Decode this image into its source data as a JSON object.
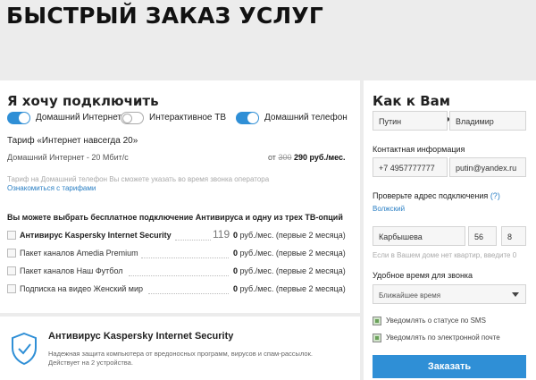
{
  "title": "БЫСТРЫЙ ЗАКАЗ УСЛУГ",
  "services": {
    "heading": "Я хочу подключить",
    "toggles": [
      {
        "label": "Домашний Интернет",
        "state": "on"
      },
      {
        "label": "Интерактивное ТВ",
        "state": "off"
      },
      {
        "label": "Домашний телефон",
        "state": "on"
      }
    ],
    "tariff": "Тариф «Интернет навсегда 20»",
    "tariff_line": "Домашний Интернет - 20 Мбит/с",
    "price_prefix": "от",
    "price_old": "300",
    "price_new": "290 руб./мес.",
    "tariff_note": "Тариф на Домашний телефон Вы сможете указать во время звонка оператора",
    "tariffs_link": "Ознакомиться с тарифами",
    "options_heading": "Вы можете выбрать бесплатное подключение Антивируса и одну из трех ТВ-опций",
    "options": [
      {
        "name": "Антивирус Kaspersky Internet Security",
        "old_price": "119",
        "price": "0",
        "suffix": "руб./мес. (первые 2 месяца)",
        "bold": true
      },
      {
        "name": "Пакет каналов Amedia Premium",
        "price": "0",
        "suffix": "руб./мес. (первые 2 месяца)"
      },
      {
        "name": "Пакет каналов Наш Футбол",
        "price": "0",
        "suffix": "руб./мес. (первые 2 месяца)"
      },
      {
        "name": "Подписка на видео Женский мир",
        "price": "0",
        "suffix": "руб./мес. (первые 2 месяца)"
      }
    ]
  },
  "promo": {
    "title": "Антивирус Kaspersky Internet Security",
    "line1": "Надежная защита компьютера от вредоносных программ, вирусов и спам-рассылок.",
    "line2": "Действует на 2 устройства."
  },
  "contact": {
    "heading": "Как к Вам обращаться",
    "last_name": "Путин",
    "first_name": "Владимир",
    "contact_heading": "Контактная информация",
    "phone": "+7 4957777777",
    "email": "putin@yandex.ru",
    "address_heading": "Проверьте адрес подключения",
    "help": "(?)",
    "city": "Волжский",
    "street": "Карбышева",
    "house": "56",
    "flat": "8",
    "address_hint": "Если в Вашем доме нет квартир, введите 0",
    "time_heading": "Удобное время для звонка",
    "time_value": "Ближайшее время",
    "sms_label": "Уведомлять о статусе по SMS",
    "mail_label": "Уведомлять по электронной почте",
    "submit": "Заказать"
  },
  "colors": {
    "accent": "#2f8fd6",
    "background": "#ececec",
    "panel": "#ffffff"
  }
}
